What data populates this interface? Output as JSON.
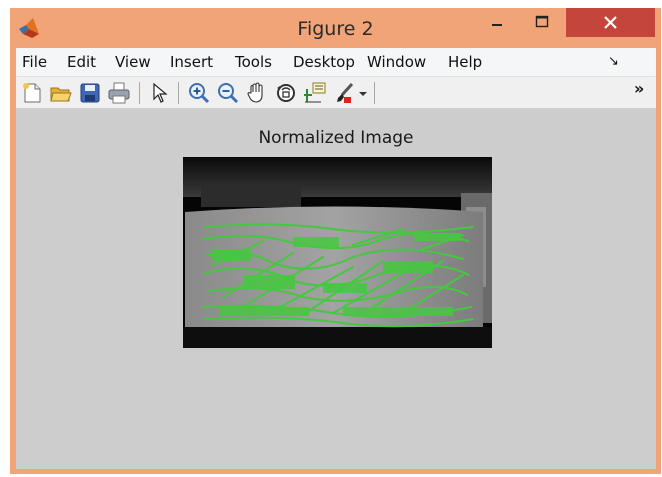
{
  "window": {
    "title": "Figure 2",
    "controls": {
      "minimize": "minimize-icon",
      "maximize": "maximize-icon",
      "close": "close-icon"
    }
  },
  "menu": {
    "items": [
      {
        "label": "File"
      },
      {
        "label": "Edit"
      },
      {
        "label": "View"
      },
      {
        "label": "Insert"
      },
      {
        "label": "Tools"
      },
      {
        "label": "Desktop"
      },
      {
        "label": "Window"
      },
      {
        "label": "Help"
      }
    ],
    "overflow_glyph": "↘"
  },
  "toolbar": {
    "tools": [
      {
        "icon": "new-figure-icon"
      },
      {
        "icon": "open-file-icon"
      },
      {
        "icon": "save-icon"
      },
      {
        "icon": "print-icon"
      },
      {
        "icon": "edit-plot-arrow-icon"
      },
      {
        "icon": "zoom-in-icon"
      },
      {
        "icon": "zoom-out-icon"
      },
      {
        "icon": "pan-hand-icon"
      },
      {
        "icon": "rotate-3d-icon"
      },
      {
        "icon": "data-cursor-icon"
      },
      {
        "icon": "brush-icon"
      },
      {
        "icon": "brush-dropdown-icon"
      }
    ],
    "overflow_glyph": "»"
  },
  "figure": {
    "axes_title": "Normalized Image",
    "image": "grayscale-tile-with-green-edge-overlay"
  },
  "colors": {
    "titlebar": "#f0a477",
    "close_button": "#c4453c",
    "figure_background": "#cdcdcd",
    "overlay": "#45c83f"
  }
}
